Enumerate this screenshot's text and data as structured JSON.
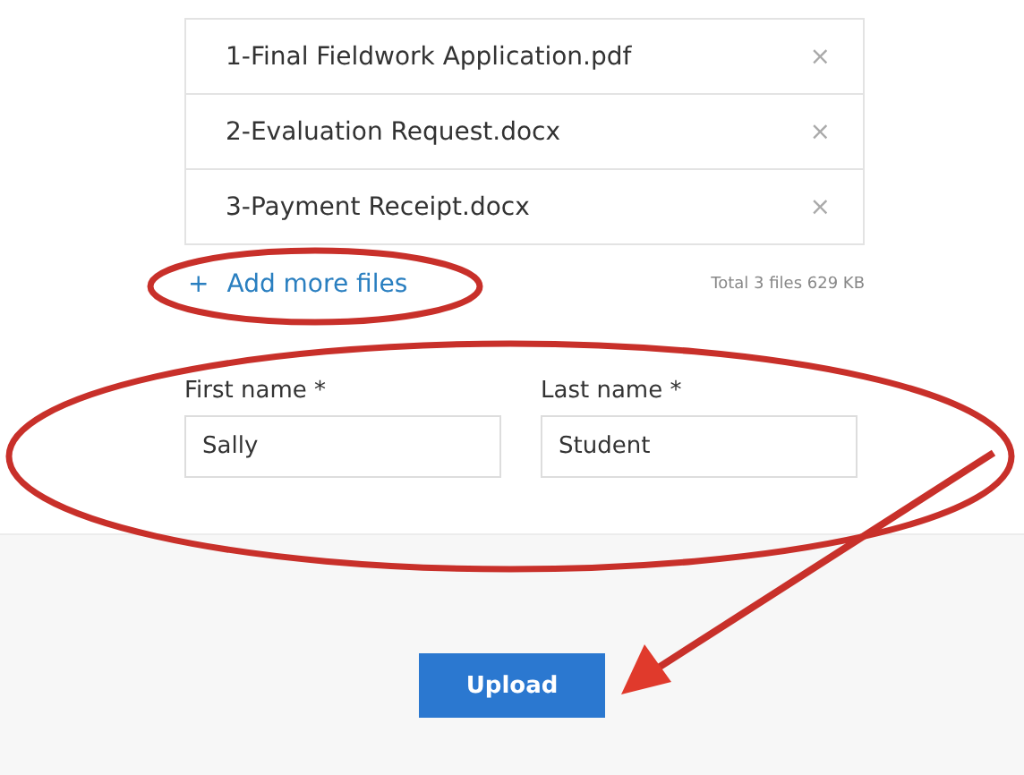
{
  "files": [
    {
      "name": "1-Final Fieldwork Application.pdf",
      "remove": "×"
    },
    {
      "name": "2-Evaluation Request.docx",
      "remove": "×"
    },
    {
      "name": "3-Payment Receipt.docx",
      "remove": "×"
    }
  ],
  "add_more": {
    "icon": "+",
    "label": "Add more files"
  },
  "total": "Total 3 files 629 KB",
  "fields": [
    {
      "label": "First name *",
      "value": "Sally"
    },
    {
      "label": "Last name *",
      "value": "Student"
    }
  ],
  "upload_button": "Upload",
  "annotations": [
    {
      "kind": "ellipse"
    },
    {
      "kind": "ellipse"
    },
    {
      "kind": "arrow"
    }
  ]
}
